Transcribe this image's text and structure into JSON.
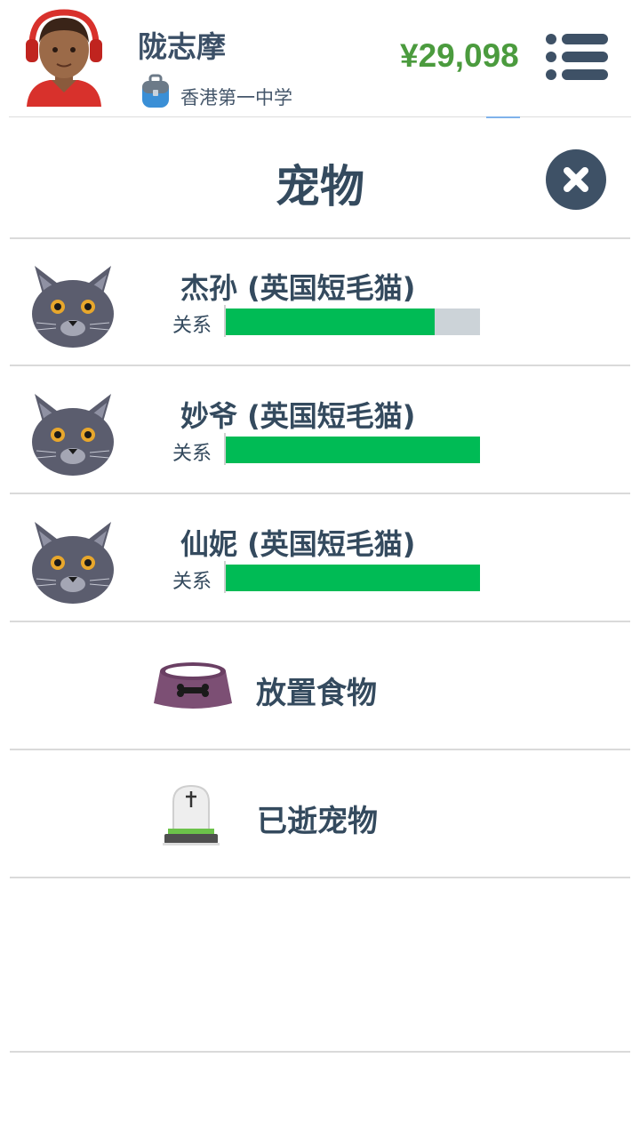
{
  "header": {
    "player_name": "陇志摩",
    "school": "香港第一中学",
    "money": "¥29,098",
    "avatar_icon": "boy-with-headphones-avatar",
    "school_icon": "school-bag-icon",
    "menu_icon": "menu-list-icon"
  },
  "dialog": {
    "title": "宠物",
    "close_icon": "close-icon"
  },
  "pets": [
    {
      "name": "杰孙 (英国短毛猫)",
      "relation_label": "关系",
      "relation": 0.82,
      "icon": "british-shorthair-cat-icon"
    },
    {
      "name": "妙爷 (英国短毛猫)",
      "relation_label": "关系",
      "relation": 1.0,
      "icon": "british-shorthair-cat-icon"
    },
    {
      "name": "仙妮 (英国短毛猫)",
      "relation_label": "关系",
      "relation": 1.0,
      "icon": "british-shorthair-cat-icon"
    }
  ],
  "actions": [
    {
      "label": "放置食物",
      "icon": "pet-food-bowl-icon"
    },
    {
      "label": "已逝宠物",
      "icon": "tombstone-icon"
    }
  ],
  "colors": {
    "text": "#344a5e",
    "money": "#4b9b3e",
    "relation_fill": "#00bb55",
    "relation_track": "#ccd3d8",
    "close_button": "#3e5166"
  }
}
